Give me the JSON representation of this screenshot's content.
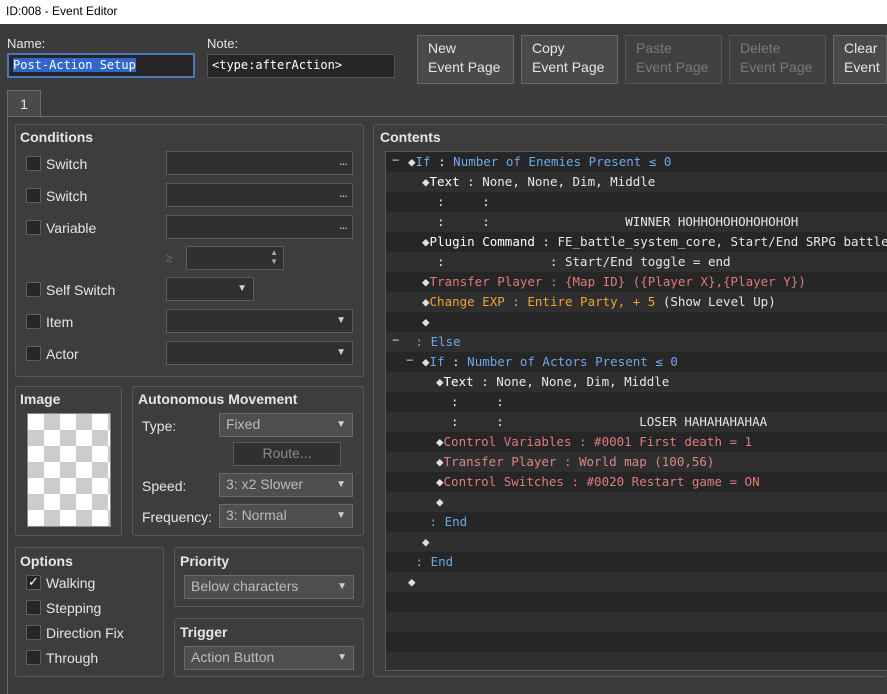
{
  "window": {
    "title": "ID:008 - Event Editor"
  },
  "header": {
    "name_label": "Name:",
    "name_value": "Post-Action Setup",
    "note_label": "Note:",
    "note_value": "<type:afterAction>",
    "buttons": [
      {
        "line1": "New",
        "line2": "Event Page",
        "enabled": true
      },
      {
        "line1": "Copy",
        "line2": "Event Page",
        "enabled": true
      },
      {
        "line1": "Paste",
        "line2": "Event Page",
        "enabled": false
      },
      {
        "line1": "Delete",
        "line2": "Event Page",
        "enabled": false
      },
      {
        "line1": "Clear",
        "line2": "Event",
        "enabled": true
      }
    ]
  },
  "tabs": [
    {
      "label": "1"
    }
  ],
  "conditions": {
    "title": "Conditions",
    "switch1": "Switch",
    "switch2": "Switch",
    "variable": "Variable",
    "var_op": "≥",
    "self_switch": "Self Switch",
    "item": "Item",
    "actor": "Actor",
    "dots": "..."
  },
  "image": {
    "title": "Image"
  },
  "movement": {
    "title": "Autonomous Movement",
    "type_label": "Type:",
    "type_value": "Fixed",
    "route_label": "Route...",
    "speed_label": "Speed:",
    "speed_value": "3: x2 Slower",
    "freq_label": "Frequency:",
    "freq_value": "3: Normal"
  },
  "options": {
    "title": "Options",
    "walking": "Walking",
    "stepping": "Stepping",
    "direction_fix": "Direction Fix",
    "through": "Through",
    "walking_checked": true
  },
  "priority": {
    "title": "Priority",
    "value": "Below characters"
  },
  "trigger": {
    "title": "Trigger",
    "value": "Action Button"
  },
  "contents": {
    "title": "Contents",
    "lines": [
      {
        "indent": 0,
        "fold": "−",
        "diamond": true,
        "parts": [
          {
            "c": "c-blue",
            "t": "If"
          },
          {
            "c": "c-white",
            "t": " : "
          },
          {
            "c": "c-blue",
            "t": "Number of Enemies Present ≤ 0"
          }
        ]
      },
      {
        "indent": 1,
        "diamond": true,
        "parts": [
          {
            "c": "c-wbold",
            "t": "Text"
          },
          {
            "c": "c-white",
            "t": " : None, None, Dim, Middle"
          }
        ]
      },
      {
        "indent": 1,
        "diamond": false,
        "parts": [
          {
            "c": "c-white",
            "t": "  :     :"
          }
        ]
      },
      {
        "indent": 1,
        "diamond": false,
        "parts": [
          {
            "c": "c-white",
            "t": "  :     :                  WINNER HOHHOHOHOHOHOHOH"
          }
        ]
      },
      {
        "indent": 1,
        "diamond": true,
        "parts": [
          {
            "c": "c-wbold",
            "t": "Plugin Command"
          },
          {
            "c": "c-white",
            "t": " : FE_battle_system_core, Start/End SRPG battle"
          }
        ]
      },
      {
        "indent": 1,
        "diamond": false,
        "parts": [
          {
            "c": "c-white",
            "t": "  :              : Start/End toggle = end"
          }
        ]
      },
      {
        "indent": 1,
        "diamond": true,
        "parts": [
          {
            "c": "c-red",
            "t": "Transfer Player : {Map ID} ({Player X},{Player Y})"
          }
        ]
      },
      {
        "indent": 1,
        "diamond": true,
        "parts": [
          {
            "c": "c-orange",
            "t": "Change EXP : Entire Party, + 5"
          },
          {
            "c": "c-white",
            "t": " (Show Level Up)"
          }
        ]
      },
      {
        "indent": 1,
        "diamond": true,
        "parts": []
      },
      {
        "indent": 0,
        "fold": "−",
        "diamond": false,
        "parts": [
          {
            "c": "c-blue",
            "t": " : Else"
          }
        ]
      },
      {
        "indent": 1,
        "fold": "−",
        "diamond": true,
        "parts": [
          {
            "c": "c-blue",
            "t": "If"
          },
          {
            "c": "c-white",
            "t": " : "
          },
          {
            "c": "c-blue",
            "t": "Number of Actors Present ≤ 0"
          }
        ]
      },
      {
        "indent": 2,
        "diamond": true,
        "parts": [
          {
            "c": "c-wbold",
            "t": "Text"
          },
          {
            "c": "c-white",
            "t": " : None, None, Dim, Middle"
          }
        ]
      },
      {
        "indent": 2,
        "diamond": false,
        "parts": [
          {
            "c": "c-white",
            "t": "  :     :"
          }
        ]
      },
      {
        "indent": 2,
        "diamond": false,
        "parts": [
          {
            "c": "c-white",
            "t": "  :     :                  LOSER HAHAHAHAHAA"
          }
        ]
      },
      {
        "indent": 2,
        "diamond": true,
        "parts": [
          {
            "c": "c-red",
            "t": "Control Variables : #0001 First death = 1"
          }
        ]
      },
      {
        "indent": 2,
        "diamond": true,
        "parts": [
          {
            "c": "c-pink",
            "t": "Transfer Player : World map (100,56)"
          }
        ]
      },
      {
        "indent": 2,
        "diamond": true,
        "parts": [
          {
            "c": "c-red",
            "t": "Control Switches : #0020 Restart game = ON"
          }
        ]
      },
      {
        "indent": 2,
        "diamond": true,
        "parts": []
      },
      {
        "indent": 1,
        "diamond": false,
        "parts": [
          {
            "c": "c-blue",
            "t": " : End"
          }
        ]
      },
      {
        "indent": 1,
        "diamond": true,
        "parts": []
      },
      {
        "indent": 0,
        "diamond": false,
        "parts": [
          {
            "c": "c-blue",
            "t": " : End"
          }
        ]
      },
      {
        "indent": 0,
        "diamond": true,
        "parts": []
      }
    ]
  }
}
